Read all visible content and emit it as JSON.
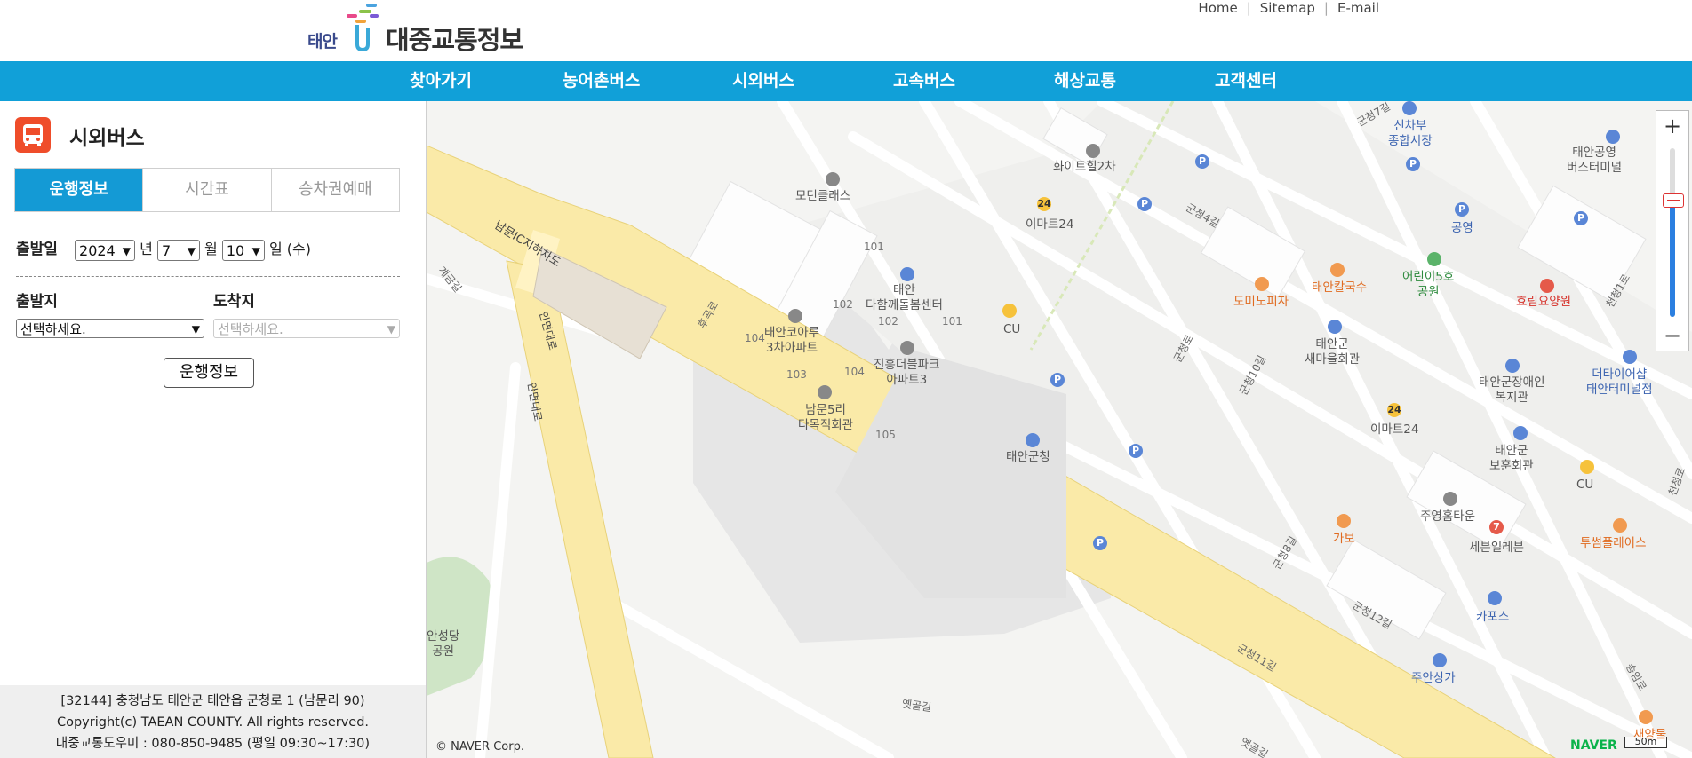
{
  "header": {
    "logo_small": "태안",
    "logo_title": "대중교통정보",
    "links": [
      "Home",
      "Sitemap",
      "E-mail"
    ]
  },
  "nav": {
    "items": [
      "찾아가기",
      "농어촌버스",
      "시외버스",
      "고속버스",
      "해상교통",
      "고객센터"
    ]
  },
  "sidebar": {
    "title": "시외버스",
    "icon": "bus-icon",
    "tabs": [
      "운행정보",
      "시간표",
      "승차권예매"
    ],
    "active_tab": "운행정보",
    "date_label": "출발일",
    "year": "2024",
    "year_suffix": "년",
    "month": "7",
    "month_suffix": "월",
    "day": "10",
    "day_suffix": "일 (수)",
    "origin_label": "출발지",
    "dest_label": "도착지",
    "origin_placeholder": "선택하세요.",
    "dest_placeholder": "선택하세요.",
    "run_button": "운행정보"
  },
  "footer": {
    "address": "[32144] 충청남도 태안군 태안읍 군청로 1 (남문리 90)",
    "copyright": "Copyright(c) TAEAN COUNTY. All rights reserved.",
    "helpline": "대중교통도우미 : 080-850-9485 (평일 09:30~17:30)"
  },
  "map": {
    "copyright": "© NAVER Corp.",
    "brand": "NAVER",
    "scale": "50m",
    "zoom_in": "+",
    "zoom_out": "−",
    "colors": {
      "highway": "#faeaa8",
      "park": "#cfe5c6",
      "block": "#e9e9e9"
    },
    "pois": [
      {
        "name": "화이트힐2차",
        "icon": "building-icon"
      },
      {
        "name": "신차부\n종합시장",
        "icon": "market-icon"
      },
      {
        "name": "태안공영\n버스터미널",
        "icon": "bus-terminal-icon"
      },
      {
        "name": "모던클래스",
        "icon": "building-icon"
      },
      {
        "name": "이마트24",
        "icon": "store-icon"
      },
      {
        "name": "공영",
        "icon": "parking-icon"
      },
      {
        "name": "어린이5호\n공원",
        "icon": "park-icon"
      },
      {
        "name": "효림요양원",
        "icon": "hospital-icon"
      },
      {
        "name": "도미노피자",
        "icon": "restaurant-icon"
      },
      {
        "name": "태안칼국수",
        "icon": "restaurant-icon"
      },
      {
        "name": "태안\n다함께돌봄센터",
        "icon": "building-icon"
      },
      {
        "name": "CU",
        "icon": "store-icon"
      },
      {
        "name": "태안코아루\n3차아파트",
        "icon": "apartment-icon"
      },
      {
        "name": "진흥더블파크\n아파트3",
        "icon": "apartment-icon"
      },
      {
        "name": "태안군\n새마을회관",
        "icon": "hall-icon"
      },
      {
        "name": "태안군장애인\n복지관",
        "icon": "building-icon"
      },
      {
        "name": "더타이어샵\n태안터미널점",
        "icon": "shop-icon"
      },
      {
        "name": "남문5리\n다목적회관",
        "icon": "hall-icon"
      },
      {
        "name": "태안군청",
        "icon": "government-icon"
      },
      {
        "name": "이마트24",
        "icon": "store-icon"
      },
      {
        "name": "태안군\n보훈회관",
        "icon": "hall-icon"
      },
      {
        "name": "CU",
        "icon": "store-icon"
      },
      {
        "name": "주영홈타운",
        "icon": "apartment-icon"
      },
      {
        "name": "가보",
        "icon": "restaurant-icon"
      },
      {
        "name": "세븐일레븐",
        "icon": "store-icon"
      },
      {
        "name": "투썸플레이스",
        "icon": "cafe-icon"
      },
      {
        "name": "카포스",
        "icon": "shop-icon"
      },
      {
        "name": "주안상가",
        "icon": "building-icon"
      },
      {
        "name": "새양물",
        "icon": "restaurant-icon"
      },
      {
        "name": "안성당\n공원",
        "icon": "park-icon"
      }
    ],
    "roads": [
      "남문IC지하차도",
      "안면대로",
      "안면대로",
      "군청로",
      "군청4길",
      "군청7길",
      "군청10길",
      "군청8길",
      "군청12길",
      "군청11길",
      "옛골길",
      "옛골길",
      "천청1로",
      "송암로",
      "후곡로",
      "계금길",
      "천청로"
    ],
    "building_numbers": [
      "101",
      "102",
      "102",
      "101",
      "104",
      "103",
      "104",
      "105"
    ]
  }
}
